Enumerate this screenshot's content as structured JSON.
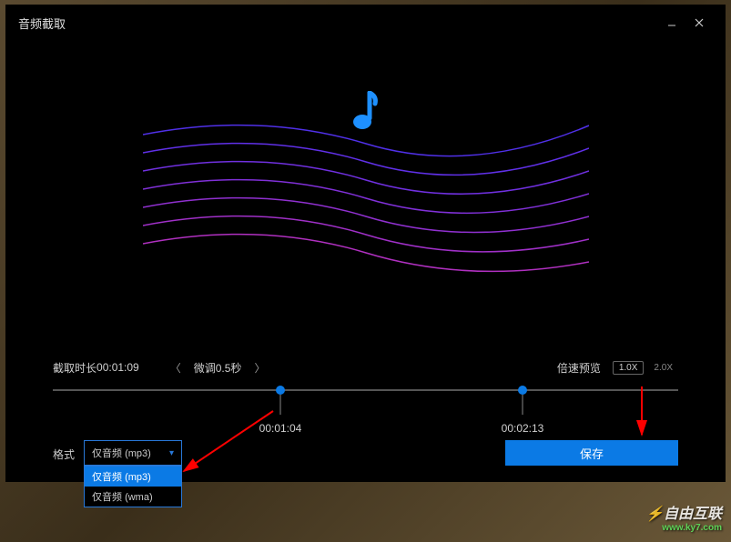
{
  "dialog": {
    "title": "音频截取"
  },
  "info": {
    "duration_label": "截取时长",
    "duration_value": "00:01:09",
    "fine_tune": "微调0.5秒",
    "speed_label": "倍速预览",
    "speed_1x": "1.0X",
    "speed_2x": "2.0X"
  },
  "timeline": {
    "start_time": "00:01:04",
    "end_time": "00:02:13"
  },
  "format": {
    "label": "格式",
    "selected": "仅音频 (mp3)",
    "options": [
      "仅音频 (mp3)",
      "仅音频 (wma)"
    ]
  },
  "actions": {
    "save": "保存"
  },
  "watermark": {
    "text": "自由互联",
    "sub": "www.ky7.com"
  }
}
